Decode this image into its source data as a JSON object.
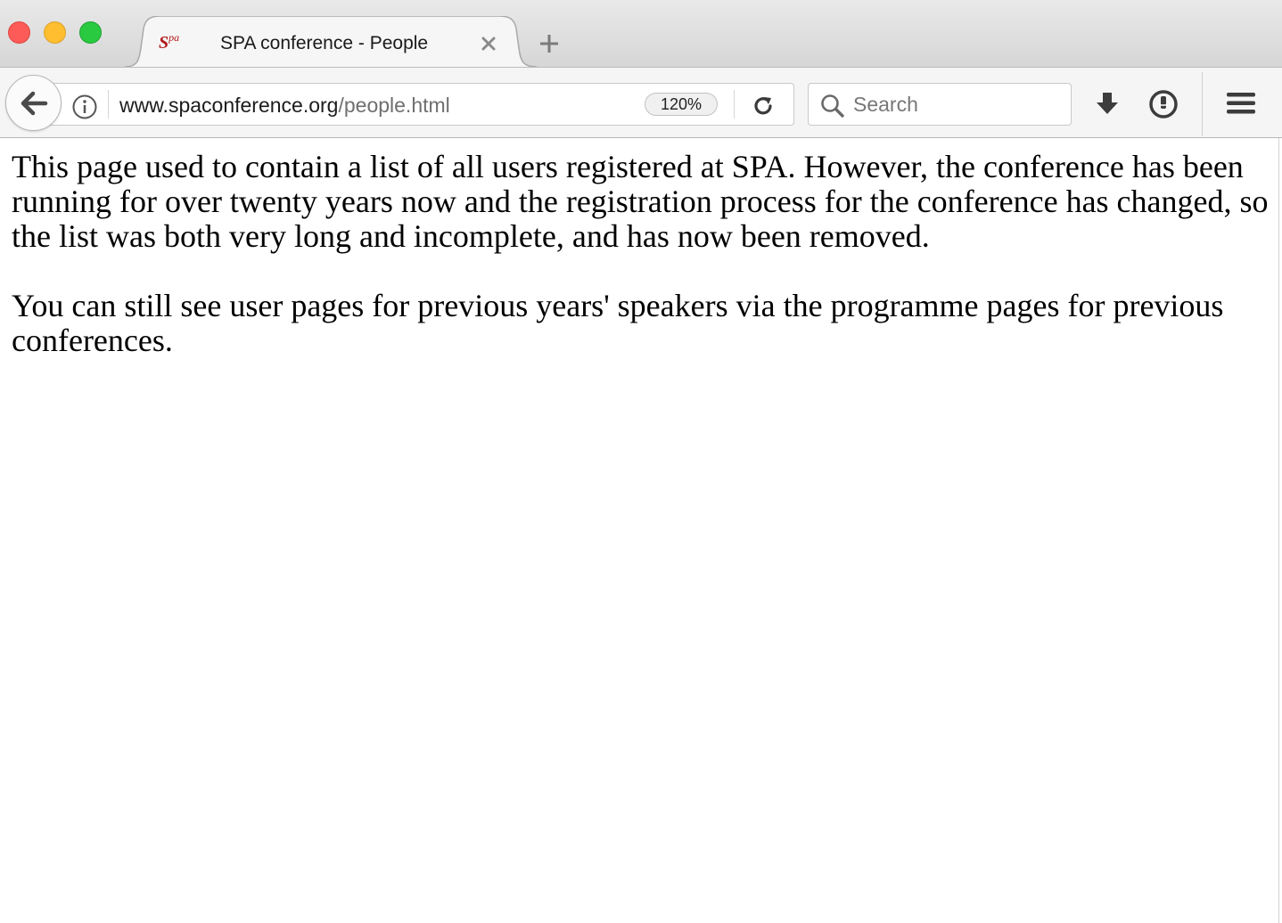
{
  "window": {
    "traffic_lights": [
      "close",
      "minimize",
      "maximize"
    ]
  },
  "tab": {
    "favicon_text": "S",
    "favicon_sup": "pa",
    "title": "SPA conference - People"
  },
  "navbar": {
    "url_domain": "www.spaconference.org",
    "url_path": "/people.html",
    "zoom": "120%",
    "search_placeholder": "Search"
  },
  "icons": {
    "back": "back-arrow-icon",
    "info": "info-icon",
    "reload": "reload-icon",
    "search": "search-icon",
    "download": "download-icon",
    "pocket": "pocket-icon",
    "menu": "hamburger-menu-icon"
  },
  "colors": {
    "favicon": "#b11a1a",
    "close": "#fc5b57",
    "minimize": "#febe2f",
    "maximize": "#29c940"
  },
  "page": {
    "paragraphs": [
      "This page used to contain a list of all users registered at SPA. However, the conference has been running for over twenty years now and the registration process for the conference has changed, so the list was both very long and incomplete, and has now been removed.",
      "You can still see user pages for previous years' speakers via the programme pages for previous conferences."
    ]
  }
}
